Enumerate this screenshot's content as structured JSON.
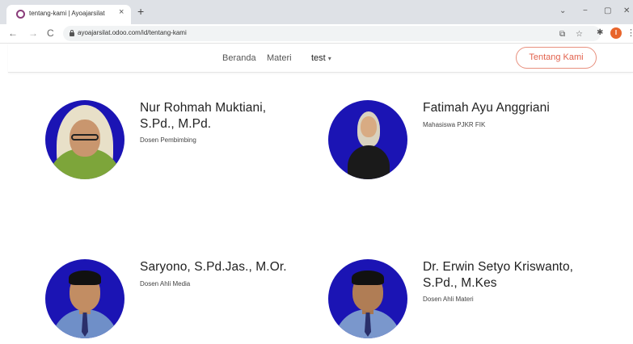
{
  "browser": {
    "tab_title": "tentang-kami | Ayoajarsilat",
    "tab_close": "×",
    "new_tab": "+",
    "url": "ayoajarsilat.odoo.com/id/tentang-kami",
    "nav_back": "←",
    "nav_forward": "→",
    "reload": "C",
    "minimize": "−",
    "restore": "▢",
    "close": "✕",
    "tab_search": "⌄",
    "share_icon": "⧉",
    "bookmark_icon": "☆",
    "extensions_icon": "✱",
    "profile_initial": "I",
    "menu": "⋮"
  },
  "header": {
    "nav": [
      {
        "label": "Beranda"
      },
      {
        "label": "Materi"
      },
      {
        "label": "test"
      }
    ],
    "dropdown_caret": "▾",
    "cta_label": "Tentang Kami"
  },
  "members": [
    {
      "name_line1": "Nur Rohmah Muktiani,",
      "name_line2": "S.Pd., M.Pd.",
      "role": "Dosen Pembimbing"
    },
    {
      "name_line1": "Fatimah Ayu Anggriani",
      "name_line2": "",
      "role": "Mahasiswa PJKR FIK"
    },
    {
      "name_line1": "Saryono, S.Pd.Jas., M.Or.",
      "name_line2": "",
      "role": "Dosen Ahli Media"
    },
    {
      "name_line1": "Dr. Erwin Setyo Kriswanto,",
      "name_line2": "S.Pd., M.Kes",
      "role": "Dosen Ahli Materi"
    }
  ],
  "colors": {
    "photo_background": "#1b14b4",
    "accent": "#e2624d",
    "hijab_green": "#7da53a",
    "hijab_cream": "#e8e0c8",
    "shirt_blue": "#6f8fc8"
  }
}
